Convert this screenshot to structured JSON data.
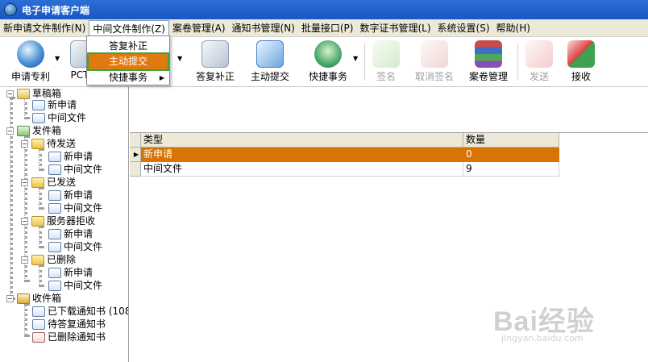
{
  "window": {
    "title": "电子申请客户端"
  },
  "menubar": [
    "新申请文件制作(N)",
    "中间文件制作(Z)",
    "案卷管理(A)",
    "通知书管理(N)",
    "批量接口(P)",
    "数字证书管理(L)",
    "系统设置(S)",
    "帮助(H)"
  ],
  "dropdown": {
    "items": [
      "答复补正",
      "主动提交",
      "快捷事务"
    ]
  },
  "toolbar": {
    "new_patent": "申请专利",
    "pct": "PCT",
    "reply": "答复补正",
    "submit": "主动提交",
    "quick": "快捷事务",
    "sign": "签名",
    "unsign": "取消签名",
    "case_mgmt": "案卷管理",
    "send": "发送",
    "receive": "接收"
  },
  "tree": {
    "draft": "草稿箱",
    "draft_new": "新申请",
    "draft_mid": "中间文件",
    "outbox": "发件箱",
    "pending": "待发送",
    "pending_new": "新申请",
    "pending_mid": "中间文件",
    "sent": "已发送",
    "sent_new": "新申请",
    "sent_mid": "中间文件",
    "rejected": "服务器拒收",
    "rejected_new": "新申请",
    "rejected_mid": "中间文件",
    "deleted": "已删除",
    "deleted_new": "新申请",
    "deleted_mid": "中间文件",
    "inbox": "收件箱",
    "downloaded": "已下载通知书 (108",
    "to_reply": "待答复通知书",
    "deleted_notices": "已删除通知书"
  },
  "grid": {
    "headers": [
      "类型",
      "数量"
    ],
    "rows": [
      {
        "type": "新申请",
        "count": "0"
      },
      {
        "type": "中间文件",
        "count": "9"
      }
    ]
  },
  "watermark": {
    "text": "Bai经验",
    "sub": "jingyan.baidu.com"
  }
}
